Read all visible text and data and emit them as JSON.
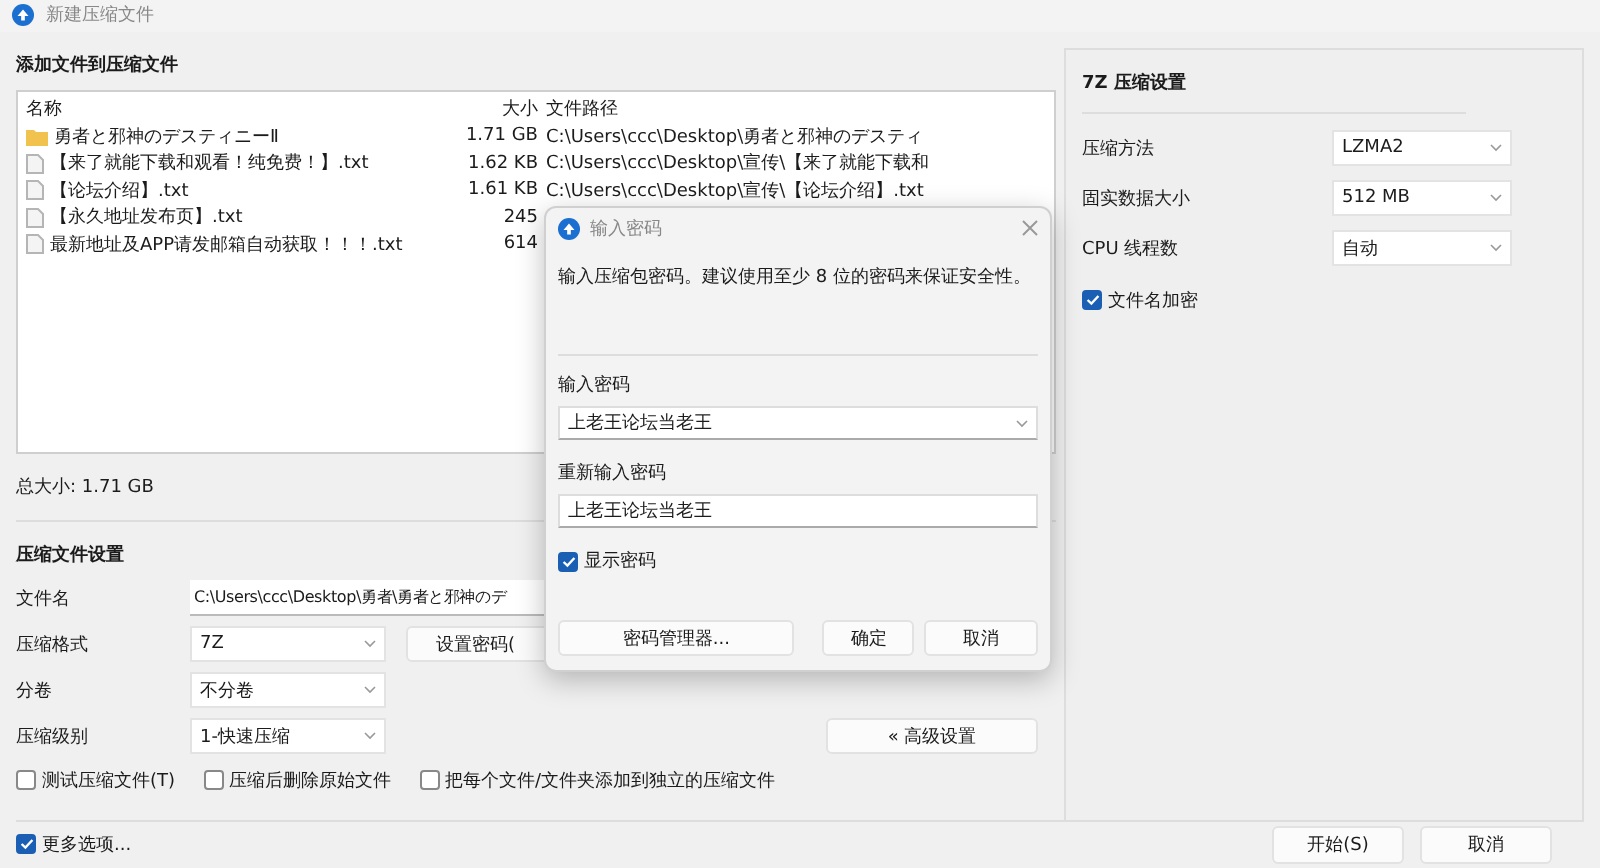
{
  "window": {
    "title": "新建压缩文件"
  },
  "files_section": {
    "title": "添加文件到压缩文件",
    "columns": [
      "名称",
      "大小",
      "文件路径"
    ],
    "rows": [
      {
        "kind": "folder",
        "name": "勇者と邪神のデスティニーⅡ",
        "size": "1.71 GB",
        "path": "C:\\Users\\ccc\\Desktop\\勇者と邪神のデスティ"
      },
      {
        "kind": "file",
        "name": "【来了就能下载和观看！纯免费！】.txt",
        "size": "1.62 KB",
        "path": "C:\\Users\\ccc\\Desktop\\宣传\\【来了就能下载和"
      },
      {
        "kind": "file",
        "name": "【论坛介绍】.txt",
        "size": "1.61 KB",
        "path": "C:\\Users\\ccc\\Desktop\\宣传\\【论坛介绍】.txt"
      },
      {
        "kind": "file",
        "name": "【永久地址发布页】.txt",
        "size": "245"
      },
      {
        "kind": "file",
        "name": "最新地址及APP请发邮箱自动获取！！！.txt",
        "size": "614"
      }
    ],
    "total": "总大小: 1.71 GB"
  },
  "settings": {
    "title": "压缩文件设置",
    "fields": [
      {
        "label": "文件名",
        "kind": "text",
        "value": "C:\\Users\\ccc\\Desktop\\勇者\\勇者と邪神のデ"
      },
      {
        "label": "压缩格式",
        "kind": "select",
        "value": "7Z",
        "button": "设置密码("
      },
      {
        "label": "分卷",
        "kind": "select",
        "value": "不分卷"
      },
      {
        "label": "压缩级别",
        "kind": "select",
        "value": "1-快速压缩",
        "button": "« 高级设置"
      }
    ],
    "options": [
      {
        "label": "测试压缩文件(T)",
        "checked": false
      },
      {
        "label": "压缩后删除原始文件",
        "checked": false
      },
      {
        "label": "把每个文件/文件夹添加到独立的压缩文件",
        "checked": false
      }
    ]
  },
  "advanced": {
    "title": "7Z 压缩设置",
    "fields": [
      {
        "label": "压缩方法",
        "value": "LZMA2"
      },
      {
        "label": "固实数据大小",
        "value": "512 MB"
      },
      {
        "label": "CPU 线程数",
        "value": "自动"
      }
    ],
    "encrypt_names": {
      "label": "文件名加密",
      "checked": true
    }
  },
  "footer": {
    "more_options": {
      "label": "更多选项...",
      "checked": true
    },
    "buttons": [
      "开始(S)",
      "取消"
    ]
  },
  "password_dialog": {
    "title": "输入密码",
    "message": "输入压缩包密码。建议使用至少 8 位的密码来保证安全性。",
    "password_label": "输入密码",
    "password": "上老王论坛当老王",
    "confirm_label": "重新输入密码",
    "confirm": "上老王论坛当老王",
    "show_password": {
      "label": "显示密码",
      "checked": true
    },
    "buttons": [
      "密码管理器...",
      "确定",
      "取消"
    ]
  }
}
